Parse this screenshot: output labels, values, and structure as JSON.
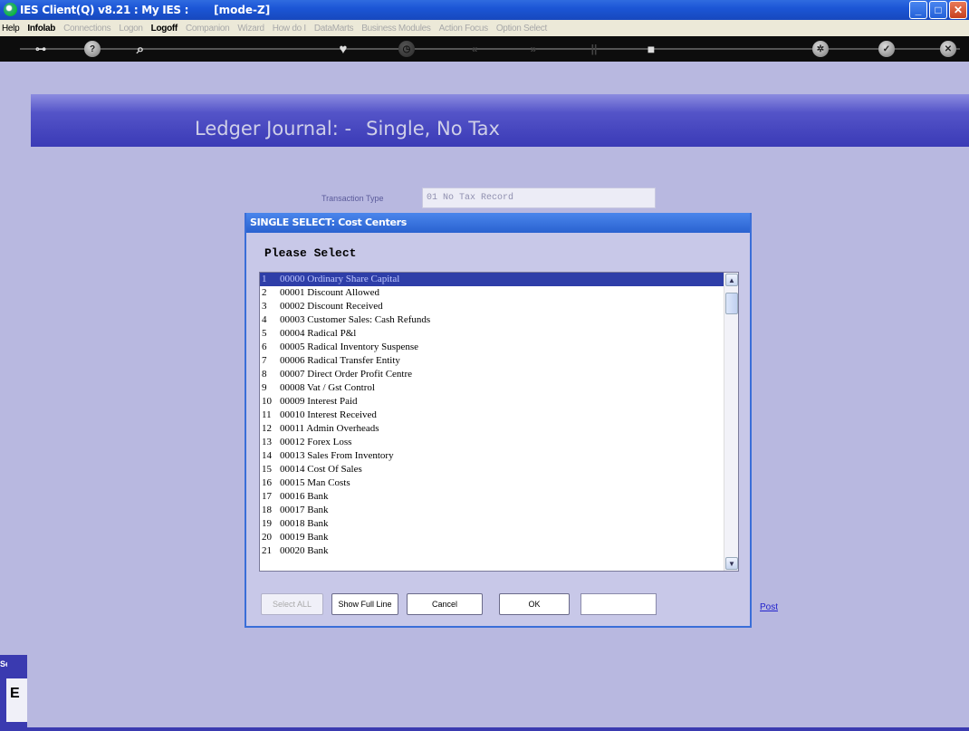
{
  "window": {
    "title": "IES Client(Q) v8.21 : My IES :",
    "mode": "[mode-Z]",
    "buttons": [
      "minimize",
      "maximize",
      "close"
    ]
  },
  "menu": [
    {
      "label": "Help",
      "state": "active"
    },
    {
      "label": "Infolab",
      "state": "bold"
    },
    {
      "label": "Connections",
      "state": "disabled"
    },
    {
      "label": "Logon",
      "state": "disabled"
    },
    {
      "label": "Logoff",
      "state": "bold"
    },
    {
      "label": "Companion",
      "state": "disabled"
    },
    {
      "label": "Wizard",
      "state": "disabled"
    },
    {
      "label": "How do I",
      "state": "disabled"
    },
    {
      "label": "DataMarts",
      "state": "disabled"
    },
    {
      "label": "Business Modules",
      "state": "disabled"
    },
    {
      "label": "Action Focus",
      "state": "disabled"
    },
    {
      "label": "Option Select",
      "state": "disabled"
    }
  ],
  "toolbar": {
    "icons": [
      "key-icon",
      "help-icon",
      "search-icon",
      "heart-icon",
      "clock-icon",
      "rewind-icon",
      "fast-forward-icon",
      "pause-icon",
      "stop-icon",
      "settings-icon",
      "ok-icon",
      "close-icon"
    ]
  },
  "page": {
    "heading": "Ledger Journal: -",
    "subheading": "Single, No Tax",
    "transaction_type_label": "Transaction Type",
    "transaction_type_value": "01 No Tax Record",
    "post_link": "Post"
  },
  "dialog": {
    "title": "SINGLE SELECT: Cost Centers",
    "prompt": "Please Select",
    "items": [
      {
        "n": "1",
        "text": "00000 Ordinary Share Capital"
      },
      {
        "n": "2",
        "text": "00001 Discount Allowed"
      },
      {
        "n": "3",
        "text": "00002 Discount Received"
      },
      {
        "n": "4",
        "text": "00003 Customer Sales: Cash Refunds"
      },
      {
        "n": "5",
        "text": "00004 Radical P&l"
      },
      {
        "n": "6",
        "text": "00005 Radical Inventory Suspense"
      },
      {
        "n": "7",
        "text": "00006 Radical Transfer Entity"
      },
      {
        "n": "8",
        "text": "00007 Direct Order Profit Centre"
      },
      {
        "n": "9",
        "text": "00008 Vat / Gst Control"
      },
      {
        "n": "10",
        "text": "00009 Interest Paid"
      },
      {
        "n": "11",
        "text": "00010 Interest Received"
      },
      {
        "n": "12",
        "text": "00011 Admin Overheads"
      },
      {
        "n": "13",
        "text": "00012 Forex Loss"
      },
      {
        "n": "14",
        "text": "00013 Sales From Inventory"
      },
      {
        "n": "15",
        "text": "00014 Cost Of Sales"
      },
      {
        "n": "16",
        "text": "00015 Man Costs"
      },
      {
        "n": "17",
        "text": "00016 Bank"
      },
      {
        "n": "18",
        "text": "00017 Bank"
      },
      {
        "n": "19",
        "text": "00018 Bank"
      },
      {
        "n": "20",
        "text": "00019 Bank"
      },
      {
        "n": "21",
        "text": "00020 Bank"
      }
    ],
    "selected_index": 0,
    "buttons": {
      "select_all": "Select ALL",
      "show_full_line": "Show Full Line",
      "cancel": "Cancel",
      "ok": "OK"
    },
    "search_value": ""
  },
  "side_tab": {
    "label": "Se",
    "glyph": "E"
  }
}
